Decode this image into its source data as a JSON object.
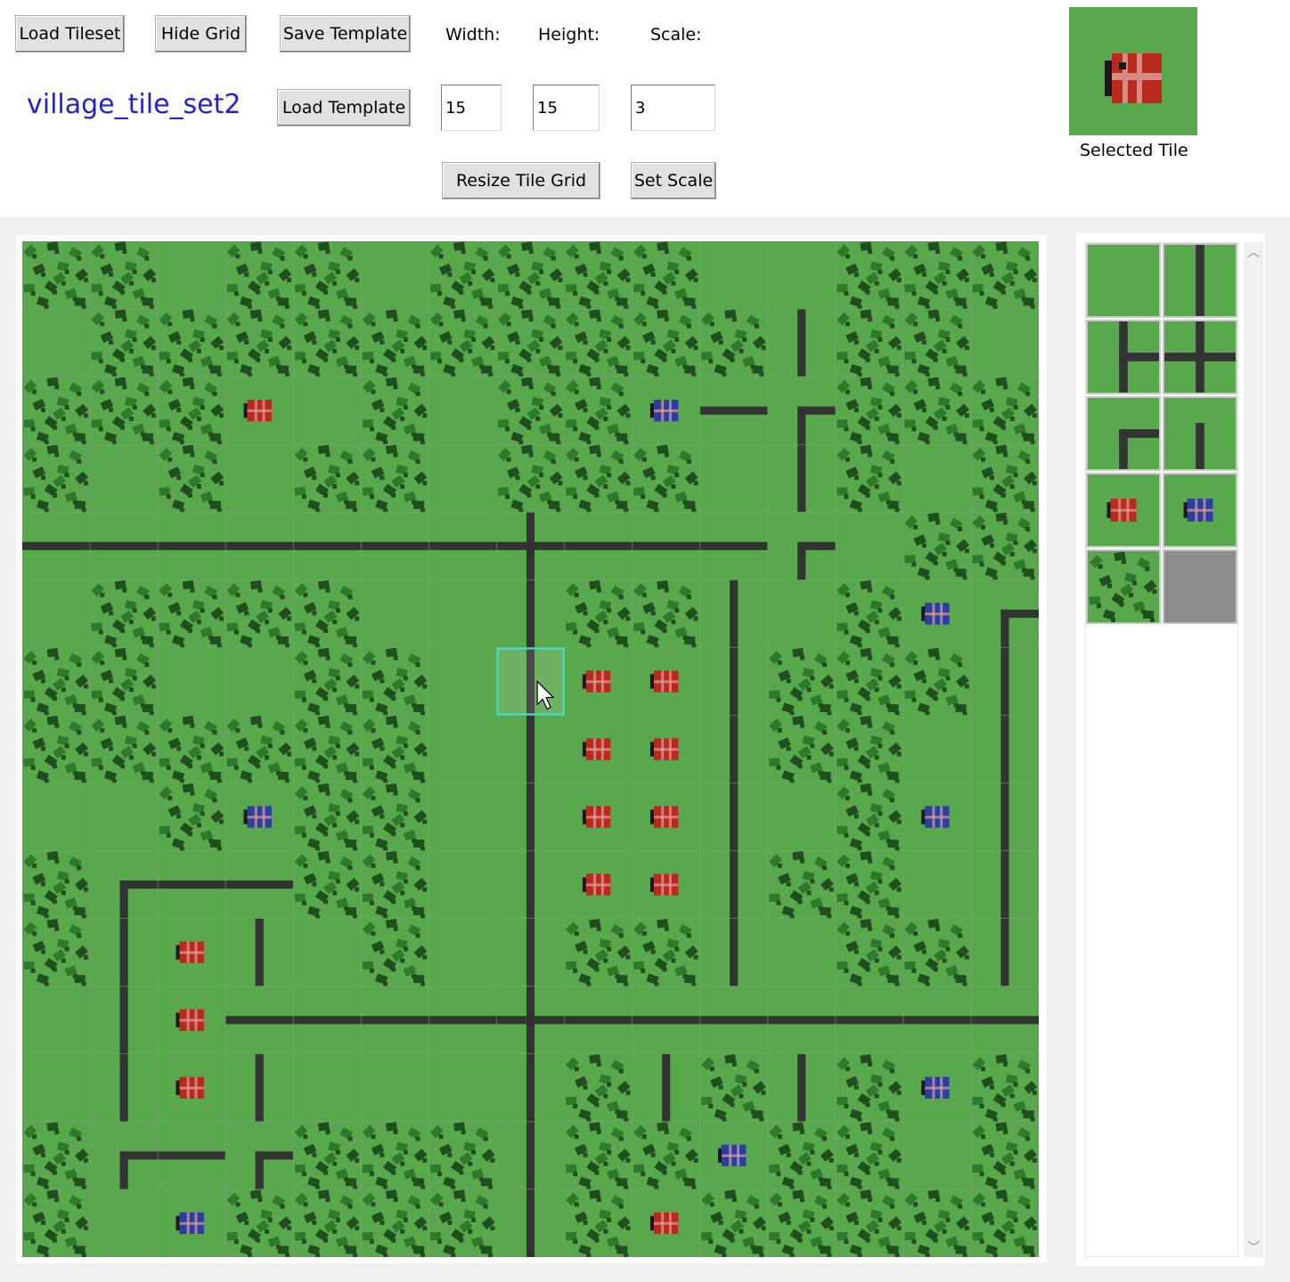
{
  "toolbar": {
    "load_tileset": "Load Tileset",
    "hide_grid": "Hide Grid",
    "save_template": "Save Template",
    "load_template": "Load Template",
    "resize_tile_grid": "Resize Tile Grid",
    "set_scale": "Set Scale",
    "width_label": "Width:",
    "height_label": "Height:",
    "scale_label": "Scale:",
    "width_value": "15",
    "height_value": "15",
    "scale_value": "3",
    "tileset_name": "village_tile_set2",
    "selected_tile_label": "Selected Tile"
  },
  "colors": {
    "grass": "#59a84d",
    "tree_dark": "#1f4f1c",
    "tree_mid": "#2f7a2a",
    "road": "#333333",
    "red_house": "#b82a1e",
    "blue_house": "#2a3fa0",
    "highlight": "#40e0d0",
    "empty_tile": "#8c8c8c",
    "tileset_name_color": "#2323c8"
  },
  "selected_tile": "red-house",
  "map": {
    "columns": 15,
    "rows": 15,
    "tile_codes": {
      "G": "grass",
      "T": "trees",
      "R": "red-house",
      "B": "blue-house",
      "V": "road-vertical",
      "H": "road-horizontal",
      "X": "road-cross",
      "L": "road-corner"
    },
    "layout_rows": [
      "TTGTTGTTTTGGTTT",
      "GTTTTTTTTTTVTTG",
      "TTTRGTGTTBHLTTT",
      "TGTGTTGTTTGVTGT",
      "HHHHHHHXHHHLGTT",
      "GTTTTGGVTTVGTBL",
      "TTGGTTGVRRVTTTV",
      "TTTTTTGVRRVTTGV",
      "GGTBTTGVRRVGTBV",
      "TLHHTTGVRRVTTGV",
      "TVRVGTGVTTVGTTV",
      "GVRHHHHXHHHHHHH",
      "GVRVGGGVTVTVTBT",
      "TLHLTTTVTTBTTGT",
      "TGBTTTTVTRTTTTT"
    ],
    "highlighted_tile": {
      "row": 6,
      "col": 7
    }
  },
  "palette": {
    "tiles": [
      "grass",
      "road-vertical",
      "road-t",
      "road-cross",
      "road-corner",
      "road-end",
      "red-house",
      "blue-house",
      "trees",
      "empty"
    ]
  }
}
